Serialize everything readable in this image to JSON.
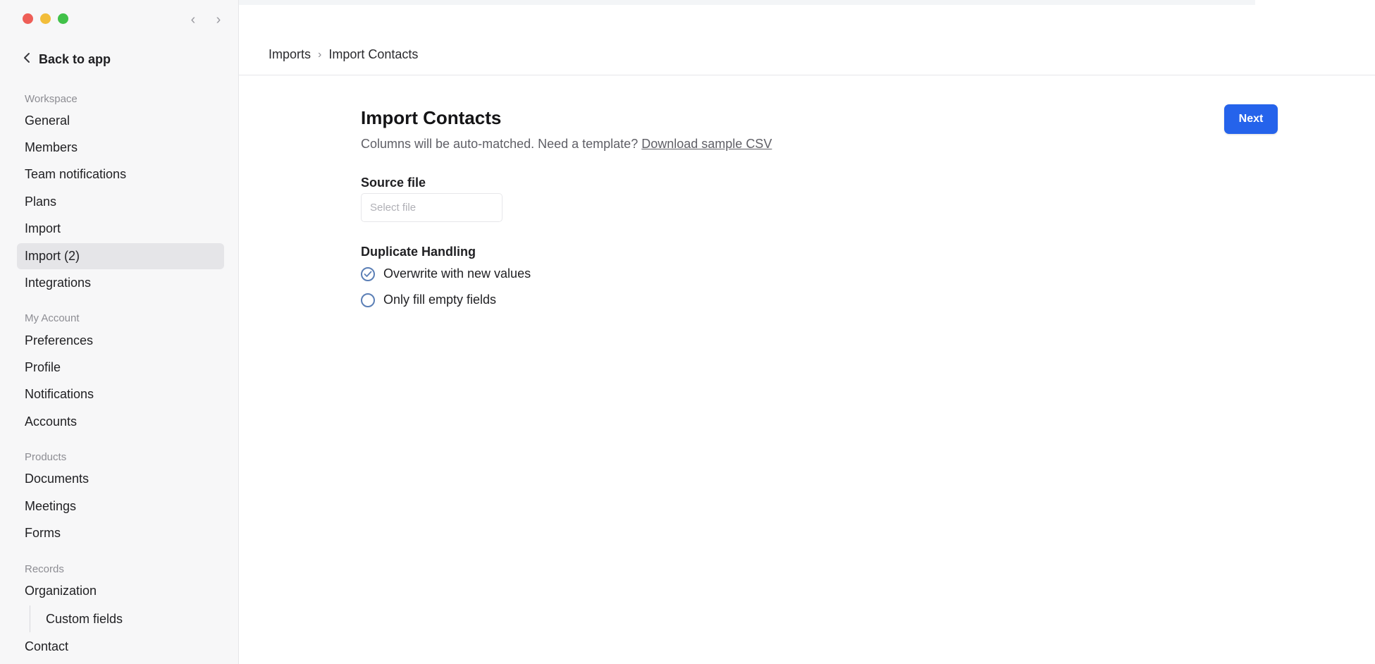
{
  "window": {
    "nav_back_glyph": "‹",
    "nav_forward_glyph": "›"
  },
  "sidebar": {
    "back_label": "Back to app",
    "sections": {
      "workspace": {
        "label": "Workspace",
        "items": [
          "General",
          "Members",
          "Team notifications",
          "Plans",
          "Import",
          "Import (2)",
          "Integrations"
        ]
      },
      "my_account": {
        "label": "My Account",
        "items": [
          "Preferences",
          "Profile",
          "Notifications",
          "Accounts"
        ]
      },
      "products": {
        "label": "Products",
        "items": [
          "Documents",
          "Meetings",
          "Forms"
        ]
      },
      "records": {
        "label": "Records",
        "items": [
          "Organization",
          "Custom fields",
          "Contact"
        ]
      }
    },
    "active_item": "Import (2)"
  },
  "breadcrumb": {
    "parent": "Imports",
    "separator": "›",
    "current": "Import Contacts"
  },
  "page": {
    "title": "Import Contacts",
    "subtitle": "Columns will be auto-matched. Need a template?",
    "template_link": "Download sample CSV",
    "next_label": "Next"
  },
  "form": {
    "source_file": {
      "label": "Source file",
      "placeholder": "Select file",
      "value": ""
    },
    "duplicate_handling": {
      "label": "Duplicate Handling",
      "options": [
        "Overwrite with new values",
        "Only fill empty fields"
      ],
      "selected": "Overwrite with new values"
    }
  },
  "colors": {
    "accent": "#2563eb",
    "sidebar_bg": "#f7f7f8",
    "active_item_bg": "#e5e5e8",
    "radio_border": "#5b7fb6"
  }
}
